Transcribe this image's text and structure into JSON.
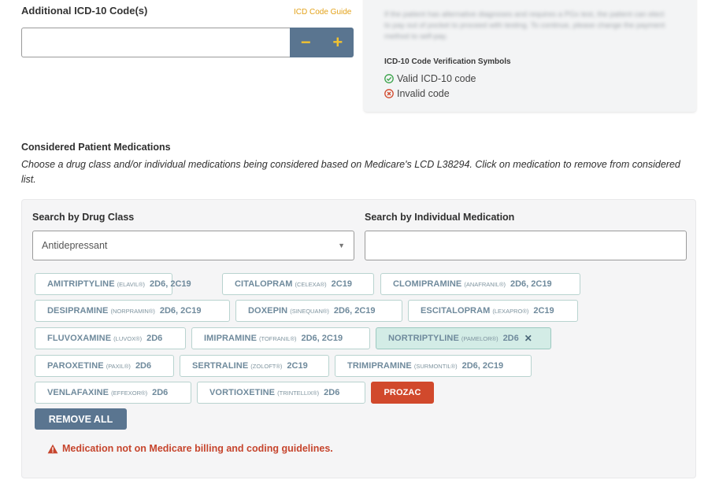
{
  "icd": {
    "label": "Additional ICD-10 Code(s)",
    "guide_link": "ICD Code Guide",
    "input_value": "",
    "minus": "−",
    "plus": "+"
  },
  "info": {
    "blurred_text": "If the patient has alternative diagnoses and requires a PGx test, the patient can elect to pay out of pocket to proceed with testing. To continue, please change the payment method to self-pay.",
    "verification_title": "ICD-10 Code Verification Symbols",
    "valid_label": "Valid ICD-10 code",
    "invalid_label": "Invalid code",
    "colors": {
      "valid": "#3aa34a",
      "invalid": "#d1492c"
    }
  },
  "considered": {
    "title": "Considered Patient Medications",
    "description": "Choose a drug class and/or individual medications being considered based on Medicare's LCD L38294. Click on medication to remove from considered list."
  },
  "search": {
    "drug_class_label": "Search by Drug Class",
    "drug_class_value": "Antidepressant",
    "individual_label": "Search by Individual Medication",
    "individual_value": ""
  },
  "medications": [
    {
      "name": "AMITRIPTYLINE",
      "brand": "(ELAVIL®)",
      "genes": "2D6, 2C19"
    },
    {
      "name": "CITALOPRAM",
      "brand": "(CELEXA®)",
      "genes": "2C19"
    },
    {
      "name": "CLOMIPRAMINE",
      "brand": "(ANAFRANIL®)",
      "genes": "2D6, 2C19"
    },
    {
      "name": "DESIPRAMINE",
      "brand": "(NORPRAMIN®)",
      "genes": "2D6, 2C19"
    },
    {
      "name": "DOXEPIN",
      "brand": "(SINEQUAN®)",
      "genes": "2D6, 2C19"
    },
    {
      "name": "ESCITALOPRAM",
      "brand": "(LEXAPRO®)",
      "genes": "2C19"
    },
    {
      "name": "FLUVOXAMINE",
      "brand": "(LUVOX®)",
      "genes": "2D6"
    },
    {
      "name": "IMIPRAMINE",
      "brand": "(TOFRANIL®)",
      "genes": "2D6, 2C19"
    },
    {
      "name": "NORTRIPTYLINE",
      "brand": "(PAMELOR®)",
      "genes": "2D6",
      "remove": "✕"
    },
    {
      "name": "PAROXETINE",
      "brand": "(PAXIL®)",
      "genes": "2D6"
    },
    {
      "name": "SERTRALINE",
      "brand": "(ZOLOFT®)",
      "genes": "2C19"
    },
    {
      "name": "TRIMIPRAMINE",
      "brand": "(SURMONTIL®)",
      "genes": "2D6, 2C19"
    },
    {
      "name": "VENLAFAXINE",
      "brand": "(EFFEXOR®)",
      "genes": "2D6"
    },
    {
      "name": "VORTIOXETINE",
      "brand": "(TRINTELLIX®)",
      "genes": "2D6"
    },
    {
      "name": "PROZAC"
    }
  ],
  "actions": {
    "remove_all": "REMOVE ALL"
  },
  "warning": {
    "icon": "warning-triangle-icon",
    "text": "Medication not on Medicare billing and coding guidelines."
  }
}
